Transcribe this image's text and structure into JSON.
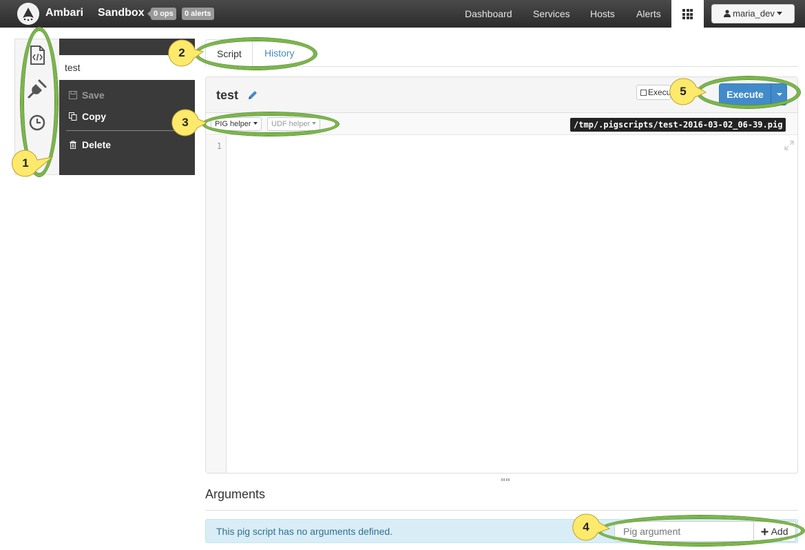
{
  "navbar": {
    "brand": "Ambari",
    "cluster": "Sandbox",
    "ops_badge": "0 ops",
    "alerts_badge": "0 alerts",
    "links": [
      "Dashboard",
      "Services",
      "Hosts",
      "Alerts"
    ],
    "user": "maria_dev"
  },
  "rail": {
    "icons": [
      "script-icon",
      "udf-plug-icon",
      "history-clock-icon"
    ]
  },
  "script_menu": {
    "script_name": "test",
    "save": "Save",
    "copy": "Copy",
    "delete": "Delete"
  },
  "tabs": {
    "script": "Script",
    "history": "History"
  },
  "editor": {
    "title": "test",
    "execute_on_tez_label": "Execute on Tez",
    "execute_button": "Execute",
    "pig_helper": "PIG helper",
    "udf_helper": "UDF helper",
    "file_path": "/tmp/.pigscripts/test-2016-03-02_06-39.pig",
    "line_number": "1"
  },
  "arguments": {
    "title": "Arguments",
    "empty_message": "This pig script has no arguments defined.",
    "input_placeholder": "Pig argument",
    "add_button": "Add"
  },
  "callouts": [
    "1",
    "2",
    "3",
    "4",
    "5"
  ],
  "colors": {
    "callout_fill": "#fde96b",
    "callout_ring": "#7ab648",
    "primary": "#428bca",
    "navbar": "#333333"
  }
}
